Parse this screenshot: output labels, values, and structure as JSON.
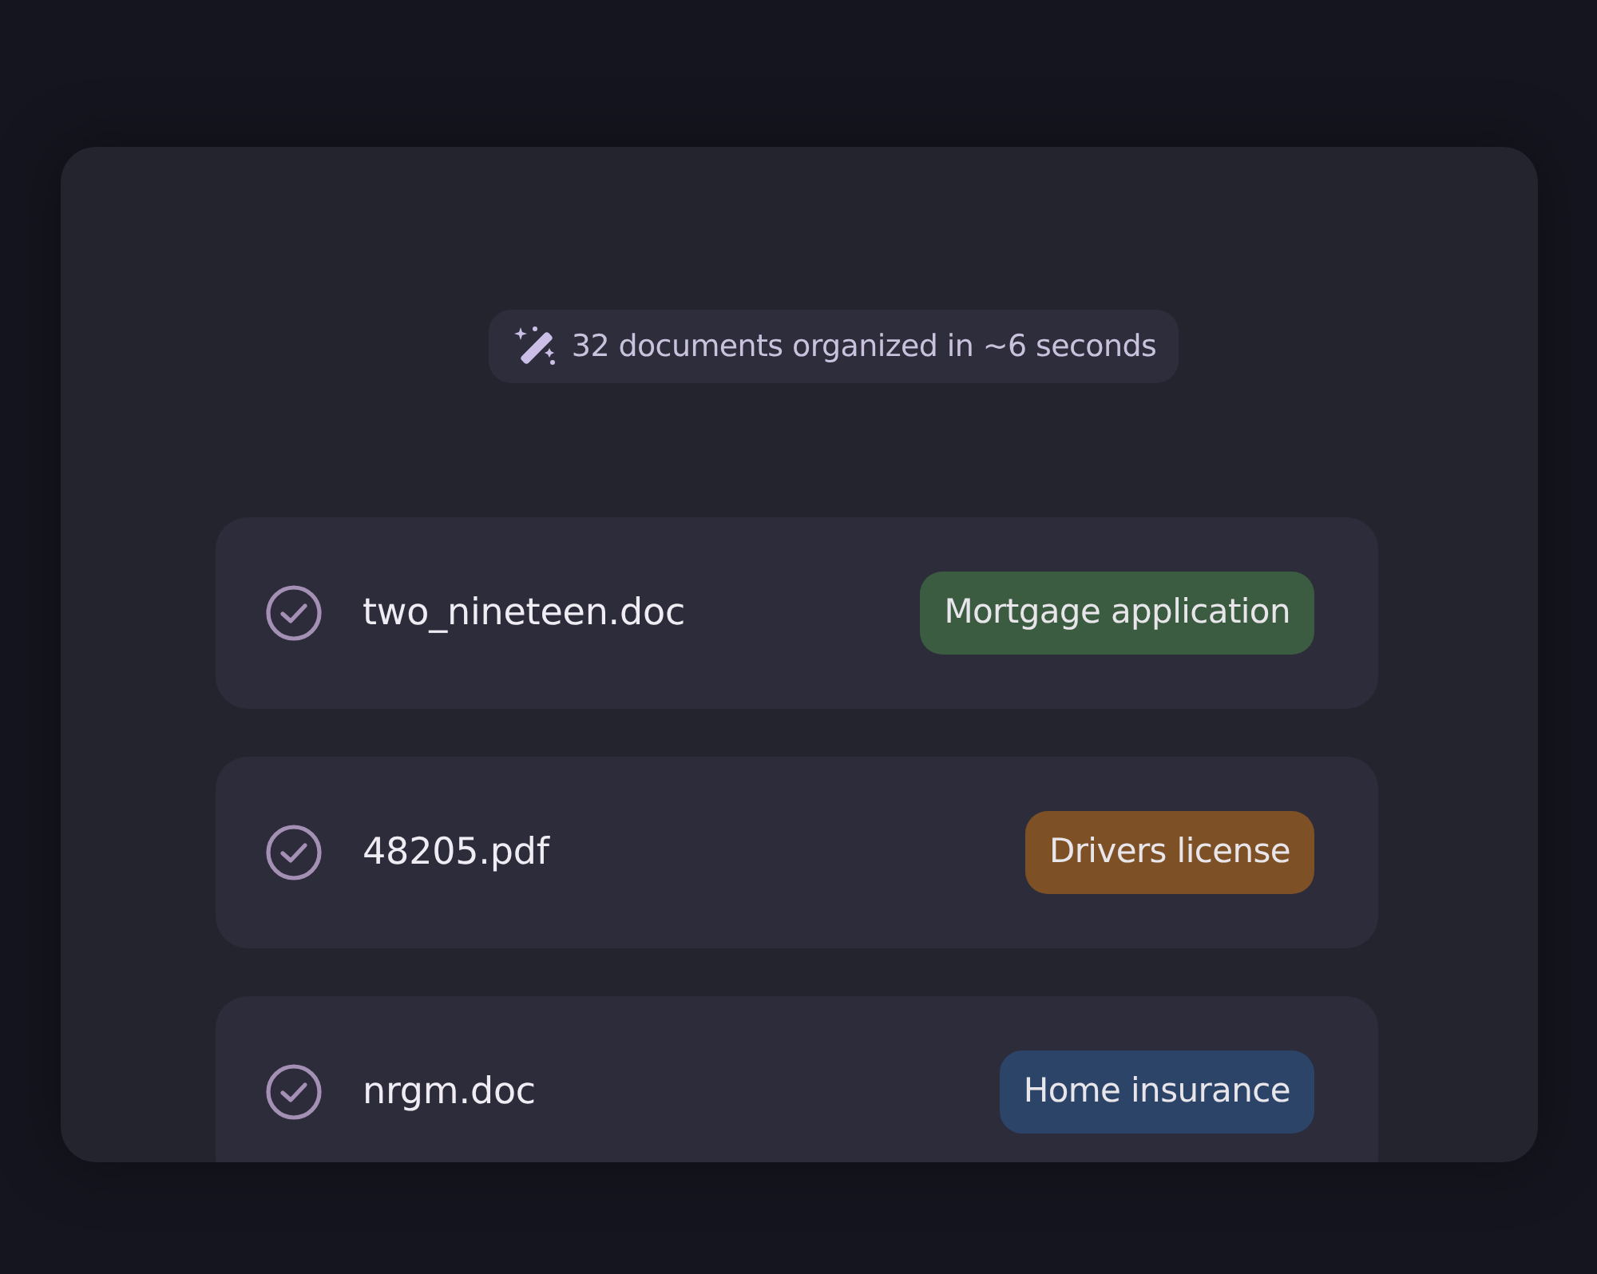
{
  "summary": {
    "text": "32 documents organized in ~6 seconds"
  },
  "documents": [
    {
      "filename": "two_nineteen.doc",
      "checked": true,
      "tag": {
        "label": "Mortgage application",
        "color": "#3b5c41"
      }
    },
    {
      "filename": "48205.pdf",
      "checked": true,
      "tag": {
        "label": "Drivers license",
        "color": "#7d5026"
      }
    },
    {
      "filename": "nrgm.doc",
      "checked": true,
      "tag": {
        "label": "Home insurance",
        "color": "#2d4469"
      }
    }
  ]
}
